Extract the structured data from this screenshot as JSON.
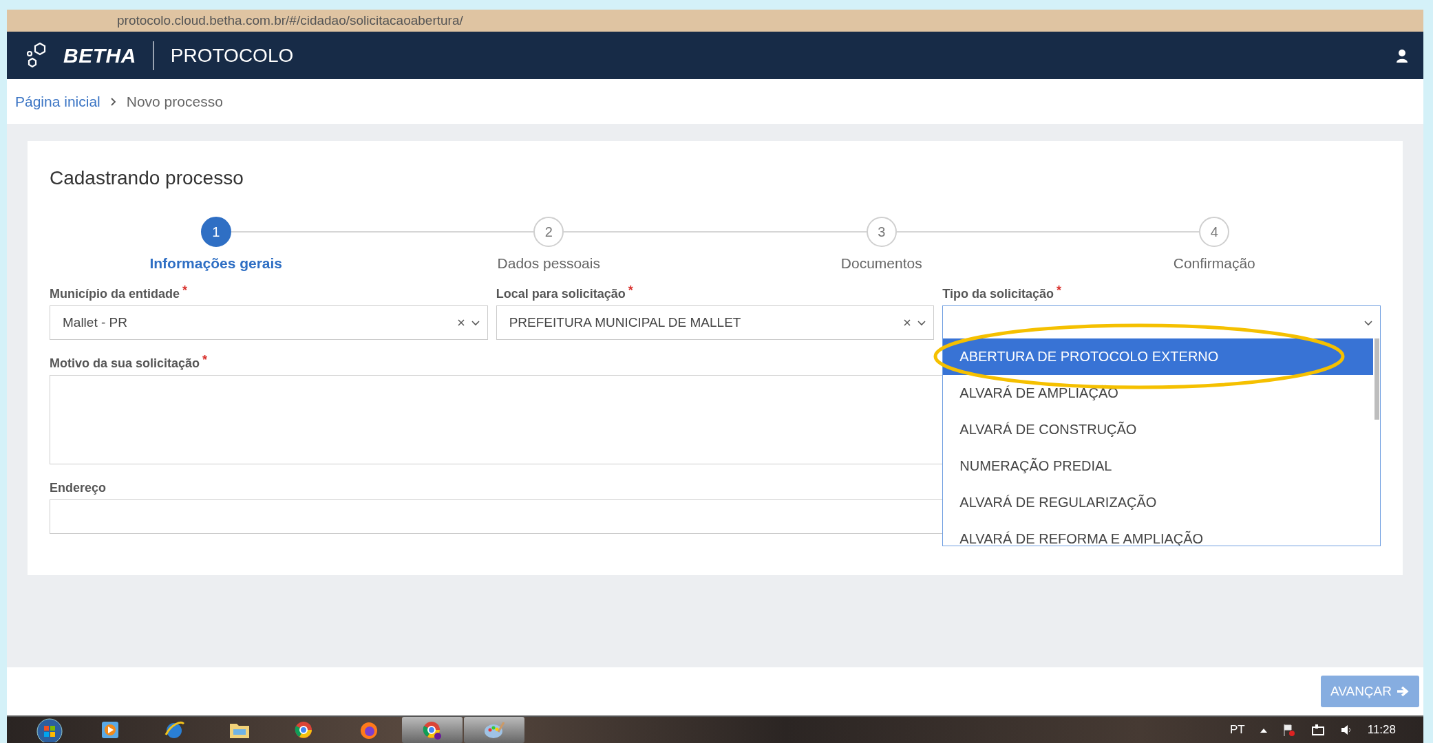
{
  "browser": {
    "address": "protocolo.cloud.betha.com.br/#/cidadao/solicitacaoabertura/"
  },
  "header": {
    "brand": "BETHA",
    "product": "PROTOCOLO"
  },
  "breadcrumb": [
    {
      "label": "Página inicial",
      "kind": "link"
    },
    {
      "label": "Novo processo",
      "kind": "current"
    }
  ],
  "page_title": "Cadastrando processo",
  "steps": [
    {
      "number": "1",
      "label": "Informações gerais",
      "selected": true
    },
    {
      "number": "2",
      "label": "Dados pessoais",
      "selected": false
    },
    {
      "number": "3",
      "label": "Documentos",
      "selected": false
    },
    {
      "number": "4",
      "label": "Confirmação",
      "selected": false
    }
  ],
  "fields": [
    {
      "kind": "select",
      "label": "Município da entidade",
      "required_mark": "*",
      "value": "Mallet - PR",
      "clearable": true,
      "open": false
    },
    {
      "kind": "select",
      "label": "Local para solicitação",
      "required_mark": "*",
      "value": "PREFEITURA MUNICIPAL DE MALLET",
      "clearable": true,
      "open": false
    },
    {
      "kind": "select",
      "label": "Tipo da solicitação",
      "required_mark": "*",
      "clearable": false,
      "open": true,
      "options": [
        {
          "label": "ABERTURA DE PROTOCOLO EXTERNO",
          "selected": true
        },
        {
          "label": "ALVARÁ DE AMPLIAÇÃO",
          "selected": false
        },
        {
          "label": "ALVARÁ DE CONSTRUÇÃO",
          "selected": false
        },
        {
          "label": "NUMERAÇÃO PREDIAL",
          "selected": false
        },
        {
          "label": "ALVARÁ DE REGULARIZAÇÃO",
          "selected": false
        },
        {
          "label": "ALVARÁ DE REFORMA E AMPLIAÇÃO",
          "selected": false
        }
      ]
    },
    {
      "kind": "textarea",
      "label": "Motivo da sua solicitação",
      "required_mark": "*"
    },
    {
      "kind": "text",
      "label": "Endereço"
    }
  ],
  "footer": {
    "next_button": "AVANÇAR",
    "disabled": true
  },
  "taskbar": {
    "language": "PT",
    "time": "11:28"
  }
}
